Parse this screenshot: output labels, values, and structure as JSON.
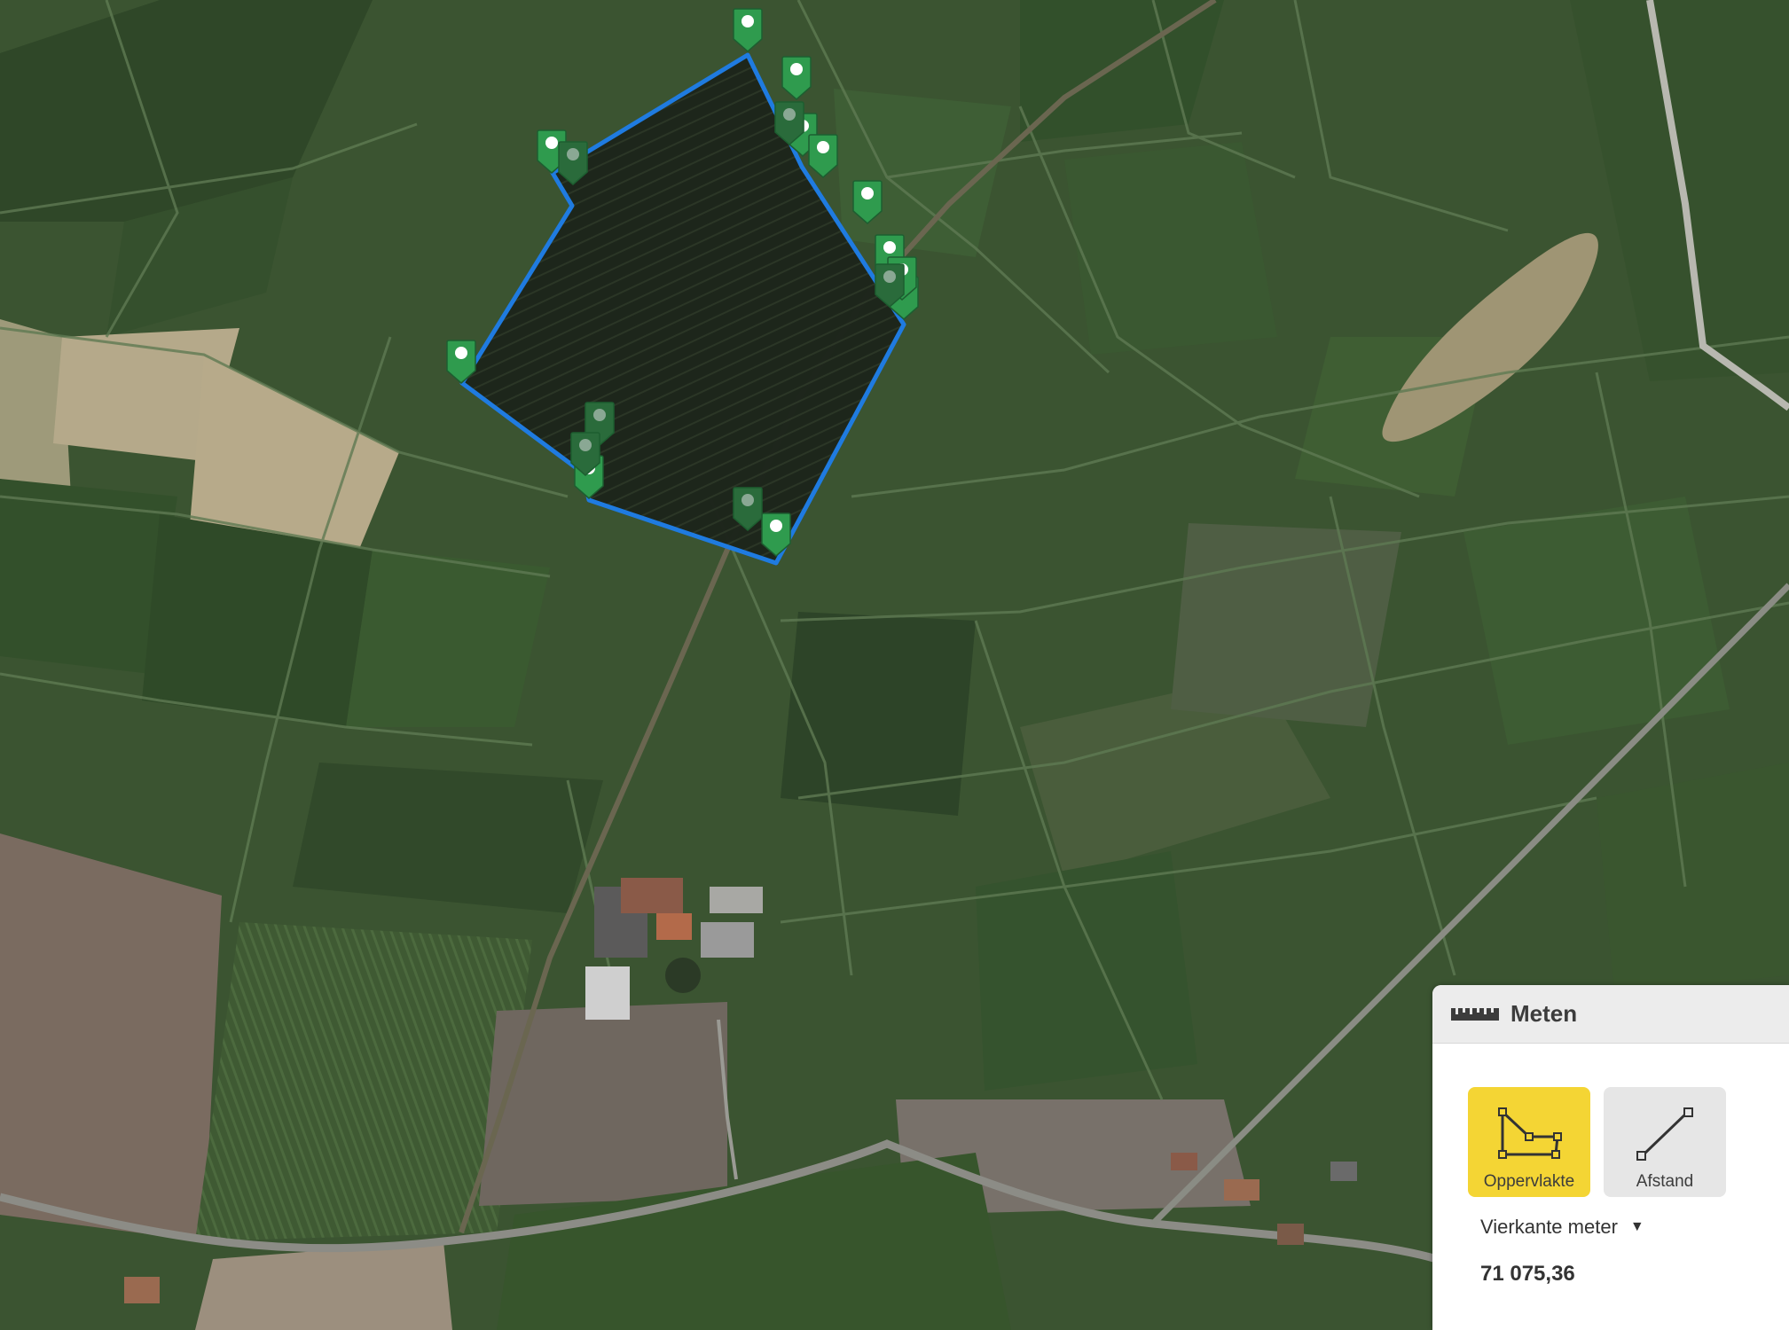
{
  "panel": {
    "title": "Meten",
    "ruler_icon": "ruler-icon",
    "tools": [
      {
        "label": "Oppervlakte",
        "icon": "polygon-area-icon",
        "active": true
      },
      {
        "label": "Afstand",
        "icon": "line-distance-icon",
        "active": false
      }
    ],
    "unit": "Vierkante meter",
    "result": "71 075,36"
  },
  "colors": {
    "polygon_outline": "#1f7be0",
    "marker": "#2f9b4e",
    "active_button": "#f4d534",
    "inactive_button": "#e6e6e6"
  }
}
